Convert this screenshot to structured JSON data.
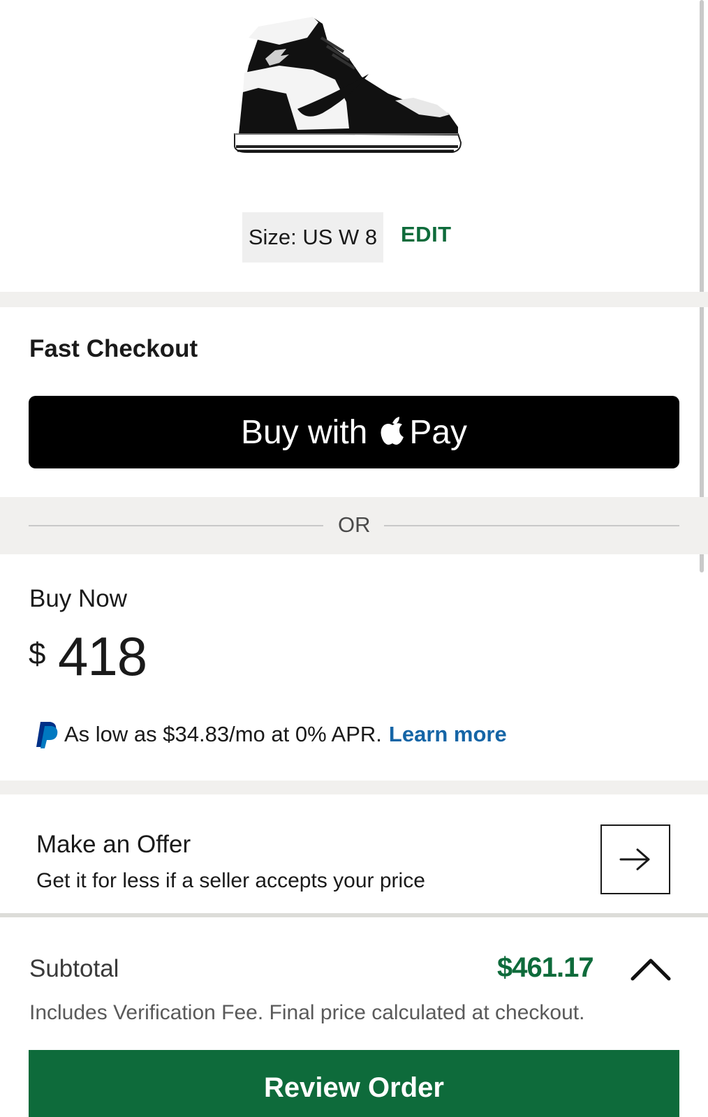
{
  "product": {
    "image_alt": "sneaker-image"
  },
  "size": {
    "label": "Size: US W 8",
    "edit_label": "EDIT"
  },
  "fast_checkout": {
    "title": "Fast Checkout",
    "applepay_prefix": "Buy with",
    "applepay_suffix": "Pay"
  },
  "divider": {
    "or_label": "OR"
  },
  "buy_now": {
    "label": "Buy Now",
    "currency": "$",
    "price": "418"
  },
  "paypal": {
    "text": "As low as $34.83/mo at 0% APR.",
    "learn_more": "Learn more"
  },
  "offer": {
    "title": "Make an Offer",
    "subtitle": "Get it for less if a seller accepts your price"
  },
  "summary": {
    "subtotal_label": "Subtotal",
    "subtotal_value": "$461.17",
    "note": "Includes Verification Fee. Final price calculated at checkout.",
    "review_button": "Review Order"
  },
  "colors": {
    "accent_green": "#0e6b3b",
    "link_blue": "#1565a6",
    "band_gray": "#f1f0ee"
  }
}
